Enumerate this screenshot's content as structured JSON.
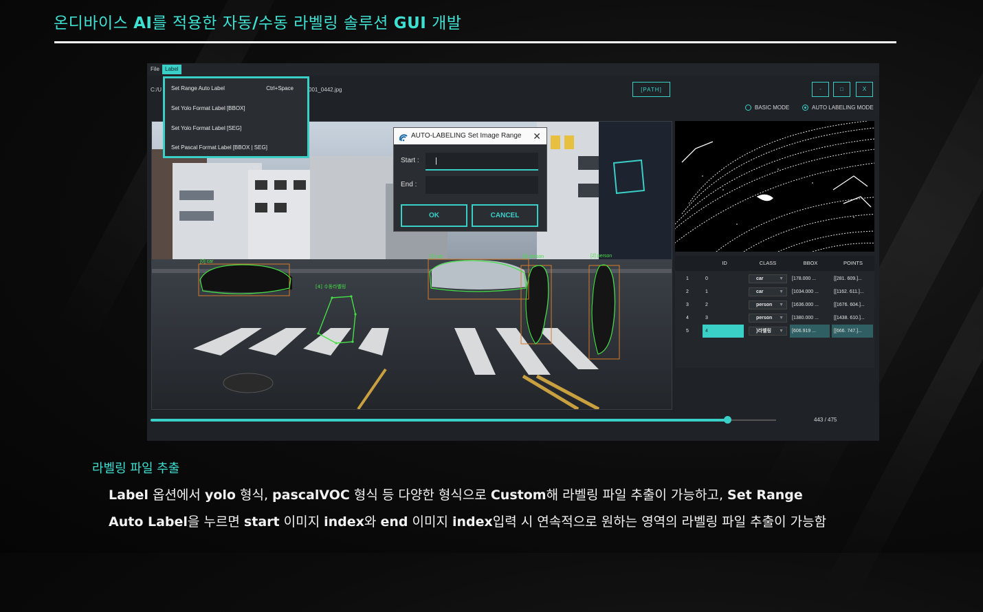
{
  "slide": {
    "title_p1": "온디바이스 ",
    "title_b1": "AI",
    "title_p2": "를 적용한 자동",
    "title_b2": "/",
    "title_p3": "수동 라벨링 솔루션 ",
    "title_b3": "GUI",
    "title_p4": " 개발",
    "subtitle": "라벨링 파일 추출",
    "desc_line1": [
      {
        "t": "Label",
        "b": true
      },
      {
        "t": " 옵션에서 ",
        "b": false
      },
      {
        "t": "yolo",
        "b": true
      },
      {
        "t": " 형식, ",
        "b": false
      },
      {
        "t": "pascalVOC",
        "b": true
      },
      {
        "t": " 형식 등 다양한 형식으로 ",
        "b": false
      },
      {
        "t": "Custom",
        "b": true
      },
      {
        "t": "해 라벨링 파일 추출이 가능하고, ",
        "b": false
      },
      {
        "t": "Set Range",
        "b": true
      }
    ],
    "desc_line2": [
      {
        "t": "Auto Label",
        "b": true
      },
      {
        "t": "을 누르면 ",
        "b": false
      },
      {
        "t": "start",
        "b": true
      },
      {
        "t": " 이미지 ",
        "b": false
      },
      {
        "t": "index",
        "b": true
      },
      {
        "t": "와 ",
        "b": false
      },
      {
        "t": "end",
        "b": true
      },
      {
        "t": " 이미지 ",
        "b": false
      },
      {
        "t": "index",
        "b": true
      },
      {
        "t": "입력 시 연속적으로 원하는 영역의 라벨링 파일 추출이 가능함",
        "b": false
      }
    ]
  },
  "app": {
    "menu": {
      "file": "File",
      "label": "Label"
    },
    "path_left": "C:/U",
    "path_right": "001_0442.jpg",
    "path_button": "[PATH]",
    "window_buttons": {
      "minimize": "-",
      "maximize": "□",
      "close": "X"
    },
    "modes": {
      "basic": "BASIC MODE",
      "auto": "AUTO LABELING MODE",
      "selected": "auto"
    },
    "dropdown": [
      {
        "label": "Set Range Auto Label",
        "shortcut": "Ctrl+Space"
      },
      {
        "label": "Set Yolo Format Label [BBOX]",
        "shortcut": ""
      },
      {
        "label": "Set Yolo Format Label [SEG]",
        "shortcut": ""
      },
      {
        "label": "Set Pascal Format Label [BBOX | SEG]",
        "shortcut": ""
      }
    ],
    "dialog": {
      "title": "AUTO-LABELING Set Image Range",
      "start_label": "Start :",
      "start_value": "|",
      "end_label": "End :",
      "end_value": "",
      "ok": "OK",
      "cancel": "CANCEL"
    },
    "annotations": [
      {
        "label": "[0] car"
      },
      {
        "label": "[1] car"
      },
      {
        "label": "[2] person"
      },
      {
        "label": "[3] person"
      },
      {
        "label": "[4] 수동라벨링"
      }
    ],
    "table": {
      "headers": [
        "ID",
        "CLASS",
        "BBOX",
        "POINTS"
      ],
      "rows": [
        {
          "n": "1",
          "id": "0",
          "class": "car",
          "bbox": "[178.000 ...",
          "points": "[[281. 609.]..."
        },
        {
          "n": "2",
          "id": "1",
          "class": "car",
          "bbox": "[1034.000 ...",
          "points": "[[1162. 611.]..."
        },
        {
          "n": "3",
          "id": "2",
          "class": "person",
          "bbox": "[1636.000 ...",
          "points": "[[1676. 604.]..."
        },
        {
          "n": "4",
          "id": "3",
          "class": "person",
          "bbox": "[1380.000 ...",
          "points": "[[1438. 610.]..."
        },
        {
          "n": "5",
          "id": "4",
          "class": "}라벨링",
          "bbox": "[606.919 ...",
          "points": "[[666. 747.]..."
        }
      ],
      "selected_row": 4
    },
    "progress": {
      "current": 443,
      "total": 475,
      "text": "443 / 475"
    },
    "accent": "#3ad0c8"
  }
}
